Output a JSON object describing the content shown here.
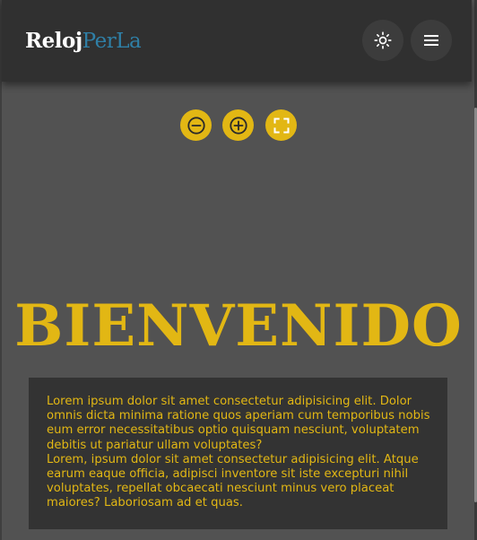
{
  "header": {
    "logo_part1": "Reloj",
    "logo_part2": "PerLa",
    "theme_icon": "sun-icon",
    "menu_icon": "hamburger-menu-icon"
  },
  "zoom_controls": {
    "zoom_out_icon": "zoom-out-icon",
    "zoom_in_icon": "zoom-in-icon",
    "fullscreen_icon": "fullscreen-icon"
  },
  "main": {
    "title": "BIENVENIDO",
    "paragraph1": "Lorem ipsum dolor sit amet consectetur adipisicing elit. Dolor omnis dicta minima ratione quos aperiam cum temporibus nobis eum error necessitatibus optio quisquam nesciunt, voluptatem debitis ut pariatur ullam voluptates?",
    "paragraph2": "Lorem, ipsum dolor sit amet consectetur adipisicing elit. Atque earum eaque officia, adipisci inventore sit iste excepturi nihil voluptates, repellat obcaecati nesciunt minus vero placeat maiores? Laboriosam ad et quas."
  },
  "colors": {
    "accent": "#e2b714",
    "background": "#525252",
    "header": "#303030",
    "text_box": "#333333",
    "logo_secondary": "#2f7fa6"
  }
}
